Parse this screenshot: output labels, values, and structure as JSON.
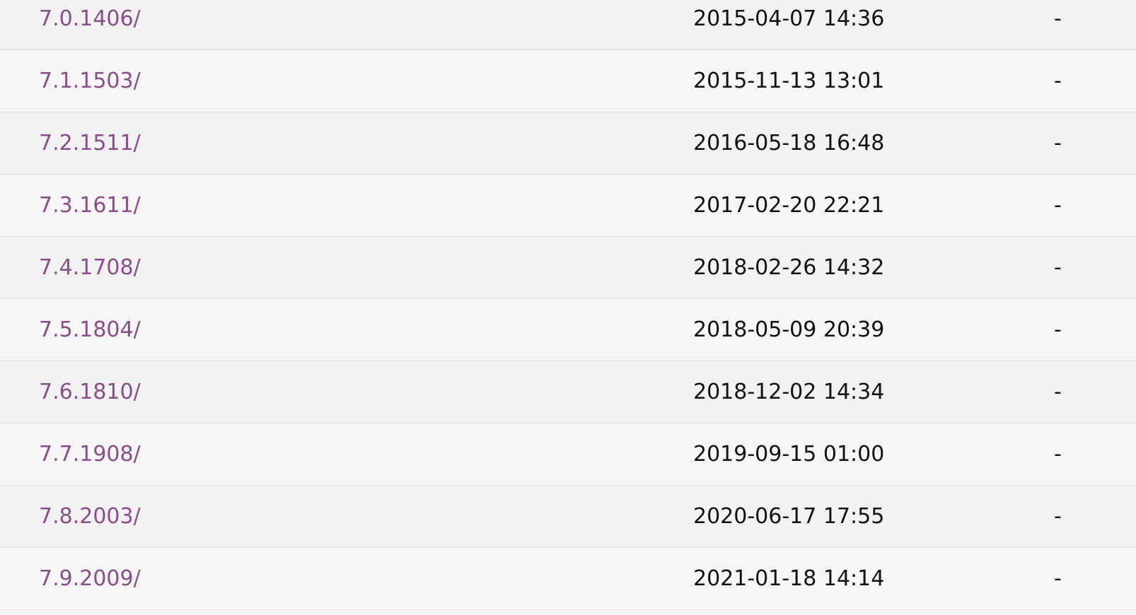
{
  "listing": {
    "rows": [
      {
        "name": "7.0.1406/",
        "modified": "2015-04-07 14:36",
        "size": "-"
      },
      {
        "name": "7.1.1503/",
        "modified": "2015-11-13 13:01",
        "size": "-"
      },
      {
        "name": "7.2.1511/",
        "modified": "2016-05-18 16:48",
        "size": "-"
      },
      {
        "name": "7.3.1611/",
        "modified": "2017-02-20 22:21",
        "size": "-"
      },
      {
        "name": "7.4.1708/",
        "modified": "2018-02-26 14:32",
        "size": "-"
      },
      {
        "name": "7.5.1804/",
        "modified": "2018-05-09 20:39",
        "size": "-"
      },
      {
        "name": "7.6.1810/",
        "modified": "2018-12-02 14:34",
        "size": "-"
      },
      {
        "name": "7.7.1908/",
        "modified": "2019-09-15 01:00",
        "size": "-"
      },
      {
        "name": "7.8.2003/",
        "modified": "2020-06-17 17:55",
        "size": "-"
      },
      {
        "name": "7.9.2009/",
        "modified": "2021-01-18 14:14",
        "size": "-"
      }
    ]
  },
  "colors": {
    "link": "#8a4d8a",
    "text": "#111111",
    "row_odd": "#f2f2f2",
    "row_even": "#f6f6f6",
    "divider": "#dfdfdf"
  }
}
